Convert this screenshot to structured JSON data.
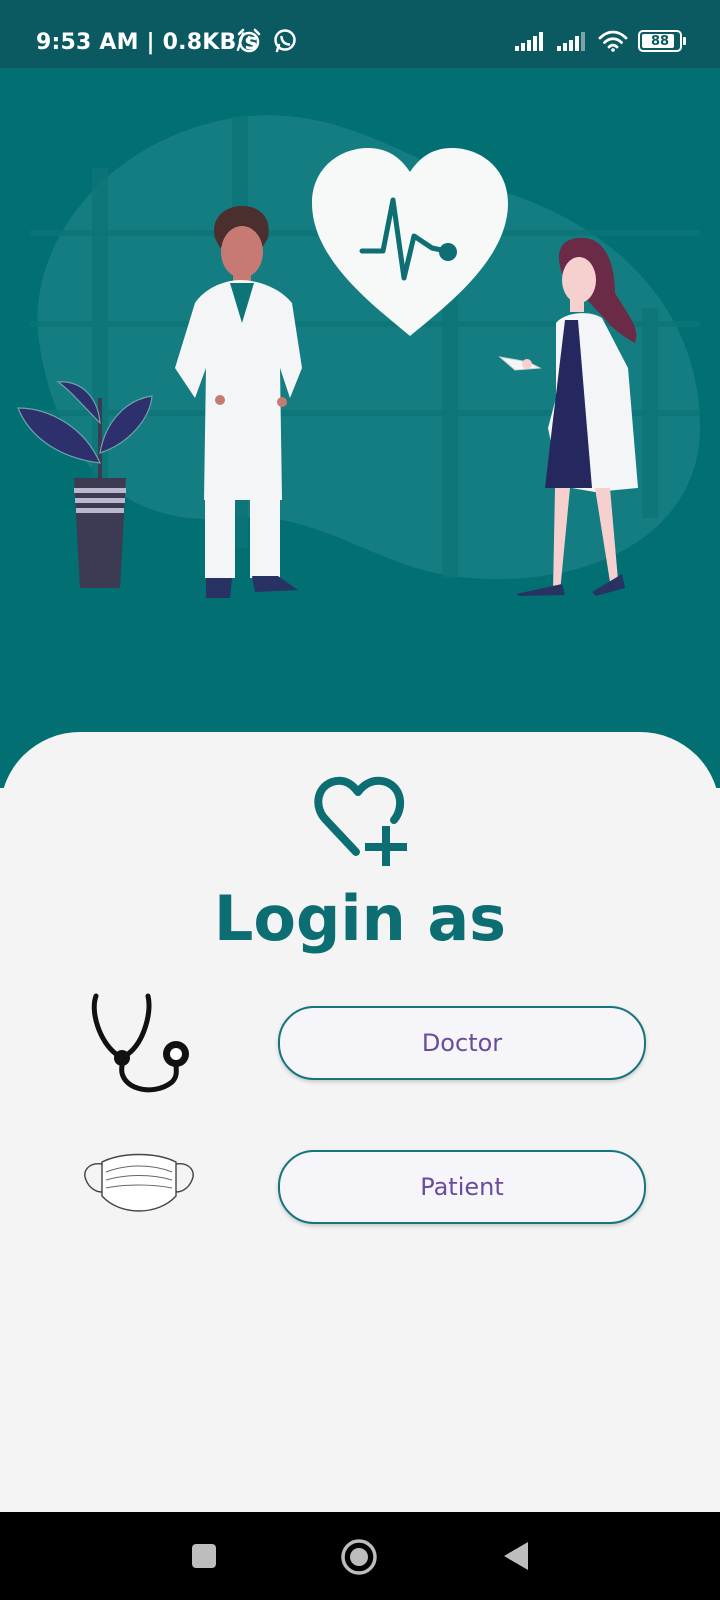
{
  "status_bar": {
    "time_speed": "9:53 AM | 0.8KB/s",
    "icons": [
      "alarm-icon",
      "whatsapp-icon",
      "signal-icon",
      "signal-icon",
      "wifi-icon"
    ],
    "battery": "88"
  },
  "hero": {
    "illustration": "doctors-heartbeat-illustration"
  },
  "login": {
    "title": "Login as",
    "logo": "heart-plus-icon",
    "roles": [
      {
        "label": "Doctor",
        "icon": "stethoscope-icon"
      },
      {
        "label": "Patient",
        "icon": "face-mask-icon"
      }
    ]
  },
  "colors": {
    "primary": "#026f73",
    "status_bar": "#0b5a61",
    "title": "#0c6e72",
    "button_text": "#6a4c9c",
    "background": "#f4f4f4"
  },
  "nav_bar": {
    "buttons": [
      "recents-button",
      "home-button",
      "back-button"
    ]
  }
}
